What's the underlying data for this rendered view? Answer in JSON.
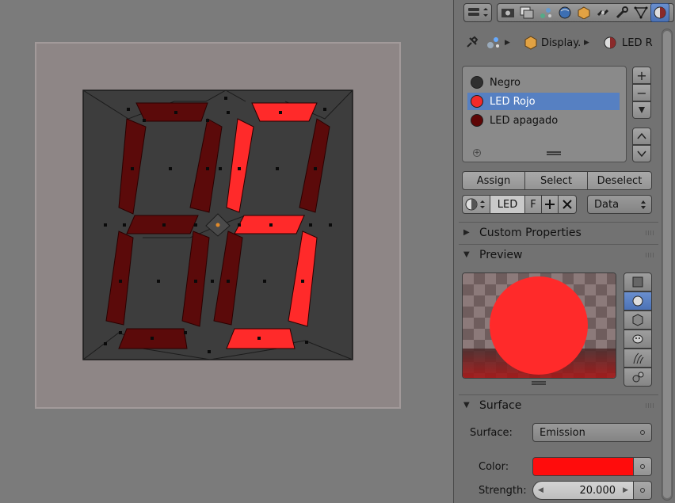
{
  "viewport": {
    "segments_on_color": "#ff2a2a",
    "segments_off_color": "#5b0a0a",
    "background_color": "#3d3d3d"
  },
  "header": {
    "context_tabs": [
      "render-icon",
      "render-layers-icon",
      "scene-icon",
      "world-icon",
      "object-icon",
      "constraints-icon",
      "modifiers-icon",
      "data-icon",
      "material-icon"
    ],
    "active_tab": "material-icon"
  },
  "path": {
    "object_label": "Display.",
    "material_label": "LED R"
  },
  "slots": [
    {
      "name": "Negro",
      "color": "#2f2f2f"
    },
    {
      "name": "LED Rojo",
      "color": "#f22a2a"
    },
    {
      "name": "LED apagado",
      "color": "#5e0606"
    }
  ],
  "selected_slot": 1,
  "slot_side_buttons": {
    "add": "+",
    "remove": "−"
  },
  "assign_row": {
    "assign": "Assign",
    "select": "Select",
    "deselect": "Deselect"
  },
  "material_row": {
    "name": "LED",
    "fake_user": "F",
    "link": "Data"
  },
  "sections": {
    "custom_properties": "Custom Properties",
    "preview": "Preview",
    "surface": "Surface"
  },
  "surface": {
    "surface_label": "Surface:",
    "surface_value": "Emission",
    "color_label": "Color:",
    "color_value": "#ff0c0c",
    "strength_label": "Strength:",
    "strength_value": "20.000"
  }
}
